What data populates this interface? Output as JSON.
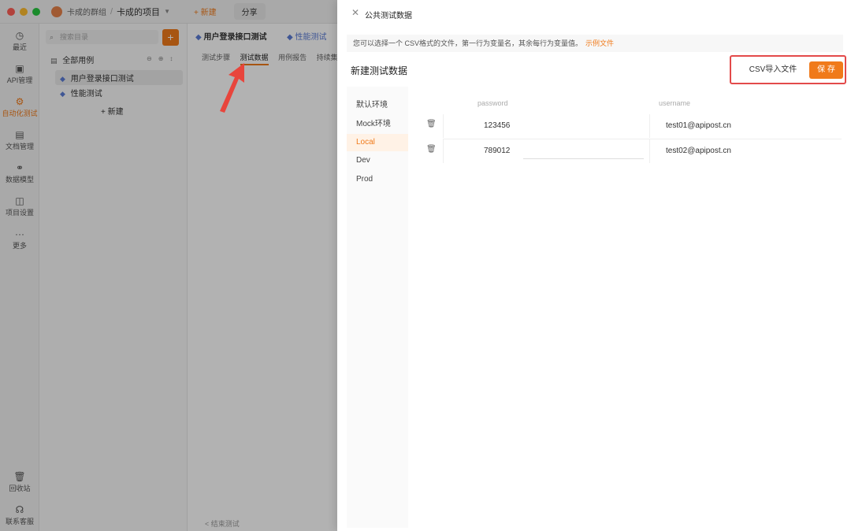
{
  "titlebar": {
    "team": "卡成的群组",
    "separator": "/",
    "project": "卡成的项目",
    "new_label": "+ 新建",
    "share_label": "分享"
  },
  "leftnav": [
    {
      "label": "最近",
      "icon": "clock-icon"
    },
    {
      "label": "API管理",
      "icon": "api-icon"
    },
    {
      "label": "自动化测试",
      "icon": "automation-icon",
      "active": true
    },
    {
      "label": "文档管理",
      "icon": "document-icon"
    },
    {
      "label": "数据模型",
      "icon": "data-model-icon"
    },
    {
      "label": "项目设置",
      "icon": "settings-icon"
    },
    {
      "label": "更多",
      "icon": "more-icon"
    },
    {
      "label": "回收站",
      "icon": "trash-icon"
    },
    {
      "label": "联系客服",
      "icon": "headset-icon"
    }
  ],
  "tree": {
    "search_placeholder": "搜索目录",
    "add_label": "+",
    "root_label": "全部用例",
    "items": [
      {
        "label": "用户登录接口测试"
      },
      {
        "label": "性能测试"
      }
    ],
    "new_label": "+ 新建"
  },
  "maincol": {
    "case_title": "用户登录接口测试",
    "second_tab": "性能测试",
    "subtabs": [
      "测试步骤",
      "测试数据",
      "用例报告",
      "持续集成"
    ],
    "active_subtab": 1,
    "bottom_hint": "< 结束测试"
  },
  "drawer": {
    "close_icon": "close-icon",
    "title": "公共测试数据",
    "tip": "您可以选择一个 CSV格式的文件，第一行为变量名，其余每行为变量值。",
    "tip_link": "示例文件",
    "section_title": "新建测试数据",
    "csv_button": "CSV导入文件",
    "save_button": "保 存",
    "environments": [
      "默认环境",
      "Mock环境",
      "Local",
      "Dev",
      "Prod"
    ],
    "active_environment": "Local",
    "table": {
      "columns": [
        "password",
        "username"
      ],
      "rows": [
        {
          "password": "123456",
          "username": "test01@apipost.cn"
        },
        {
          "password": "789012",
          "username": "test02@apipost.cn"
        }
      ]
    }
  },
  "colors": {
    "accent": "#f07a1a",
    "highlight_border": "#e34a4a",
    "arrow": "#e8453c"
  }
}
